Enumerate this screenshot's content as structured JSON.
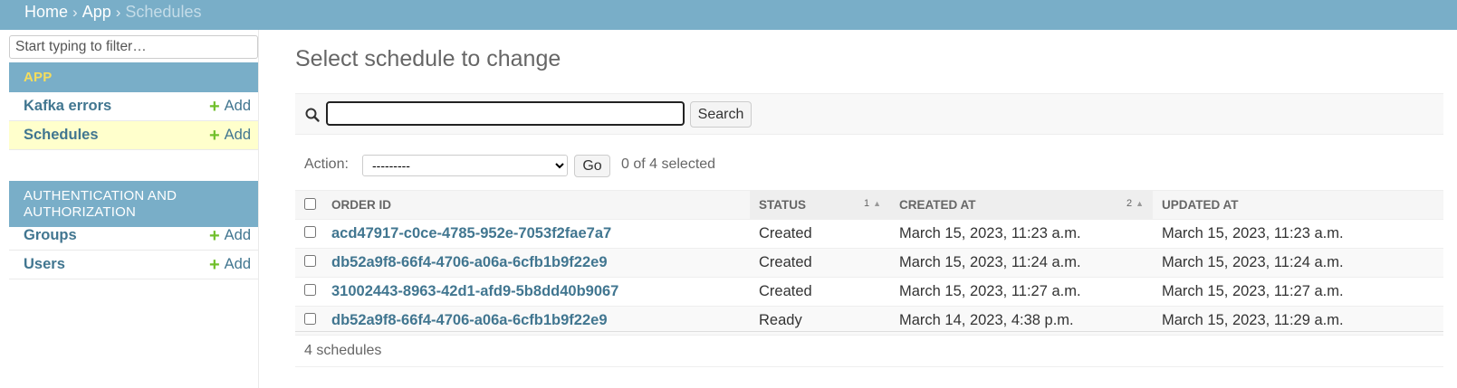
{
  "breadcrumb": {
    "home": "Home",
    "app": "App",
    "current": "Schedules",
    "separator": "›"
  },
  "sidebar": {
    "filter_placeholder": "Start typing to filter…",
    "modules": [
      {
        "caption": "APP",
        "models": [
          {
            "label": "Kafka errors",
            "add": "Add",
            "active": false
          },
          {
            "label": "Schedules",
            "add": "Add",
            "active": true
          }
        ]
      },
      {
        "caption": "AUTHENTICATION AND AUTHORIZATION",
        "models": [
          {
            "label": "Groups",
            "add": "Add",
            "active": false
          },
          {
            "label": "Users",
            "add": "Add",
            "active": false
          }
        ]
      }
    ],
    "add_symbol": "+"
  },
  "main": {
    "title": "Select schedule to change",
    "search": {
      "value": "",
      "button": "Search",
      "icon": "search-icon"
    },
    "actions": {
      "label": "Action:",
      "selected_option": "---------",
      "go": "Go",
      "count_text": "0 of 4 selected"
    },
    "table": {
      "columns": [
        {
          "label": "Order ID"
        },
        {
          "label": "Status",
          "sort_priority": "1",
          "sort_dir": "asc"
        },
        {
          "label": "Created at",
          "sort_priority": "2",
          "sort_dir": "asc"
        },
        {
          "label": "Updated at"
        }
      ],
      "rows": [
        {
          "order_id": "acd47917-c0ce-4785-952e-7053f2fae7a7",
          "status": "Created",
          "created_at": "March 15, 2023, 11:23 a.m.",
          "updated_at": "March 15, 2023, 11:23 a.m."
        },
        {
          "order_id": "db52a9f8-66f4-4706-a06a-6cfb1b9f22e9",
          "status": "Created",
          "created_at": "March 15, 2023, 11:24 a.m.",
          "updated_at": "March 15, 2023, 11:24 a.m."
        },
        {
          "order_id": "31002443-8963-42d1-afd9-5b8dd40b9067",
          "status": "Created",
          "created_at": "March 15, 2023, 11:27 a.m.",
          "updated_at": "March 15, 2023, 11:27 a.m."
        },
        {
          "order_id": "db52a9f8-66f4-4706-a06a-6cfb1b9f22e9",
          "status": "Ready",
          "created_at": "March 14, 2023, 4:38 p.m.",
          "updated_at": "March 15, 2023, 11:29 a.m."
        }
      ]
    },
    "paginator": "4 schedules"
  },
  "colors": {
    "header_bg": "#79aec8",
    "link": "#417690",
    "app_caption": "#f5dd5d",
    "add_plus": "#70bf2b",
    "active_row": "#ffffcc"
  }
}
